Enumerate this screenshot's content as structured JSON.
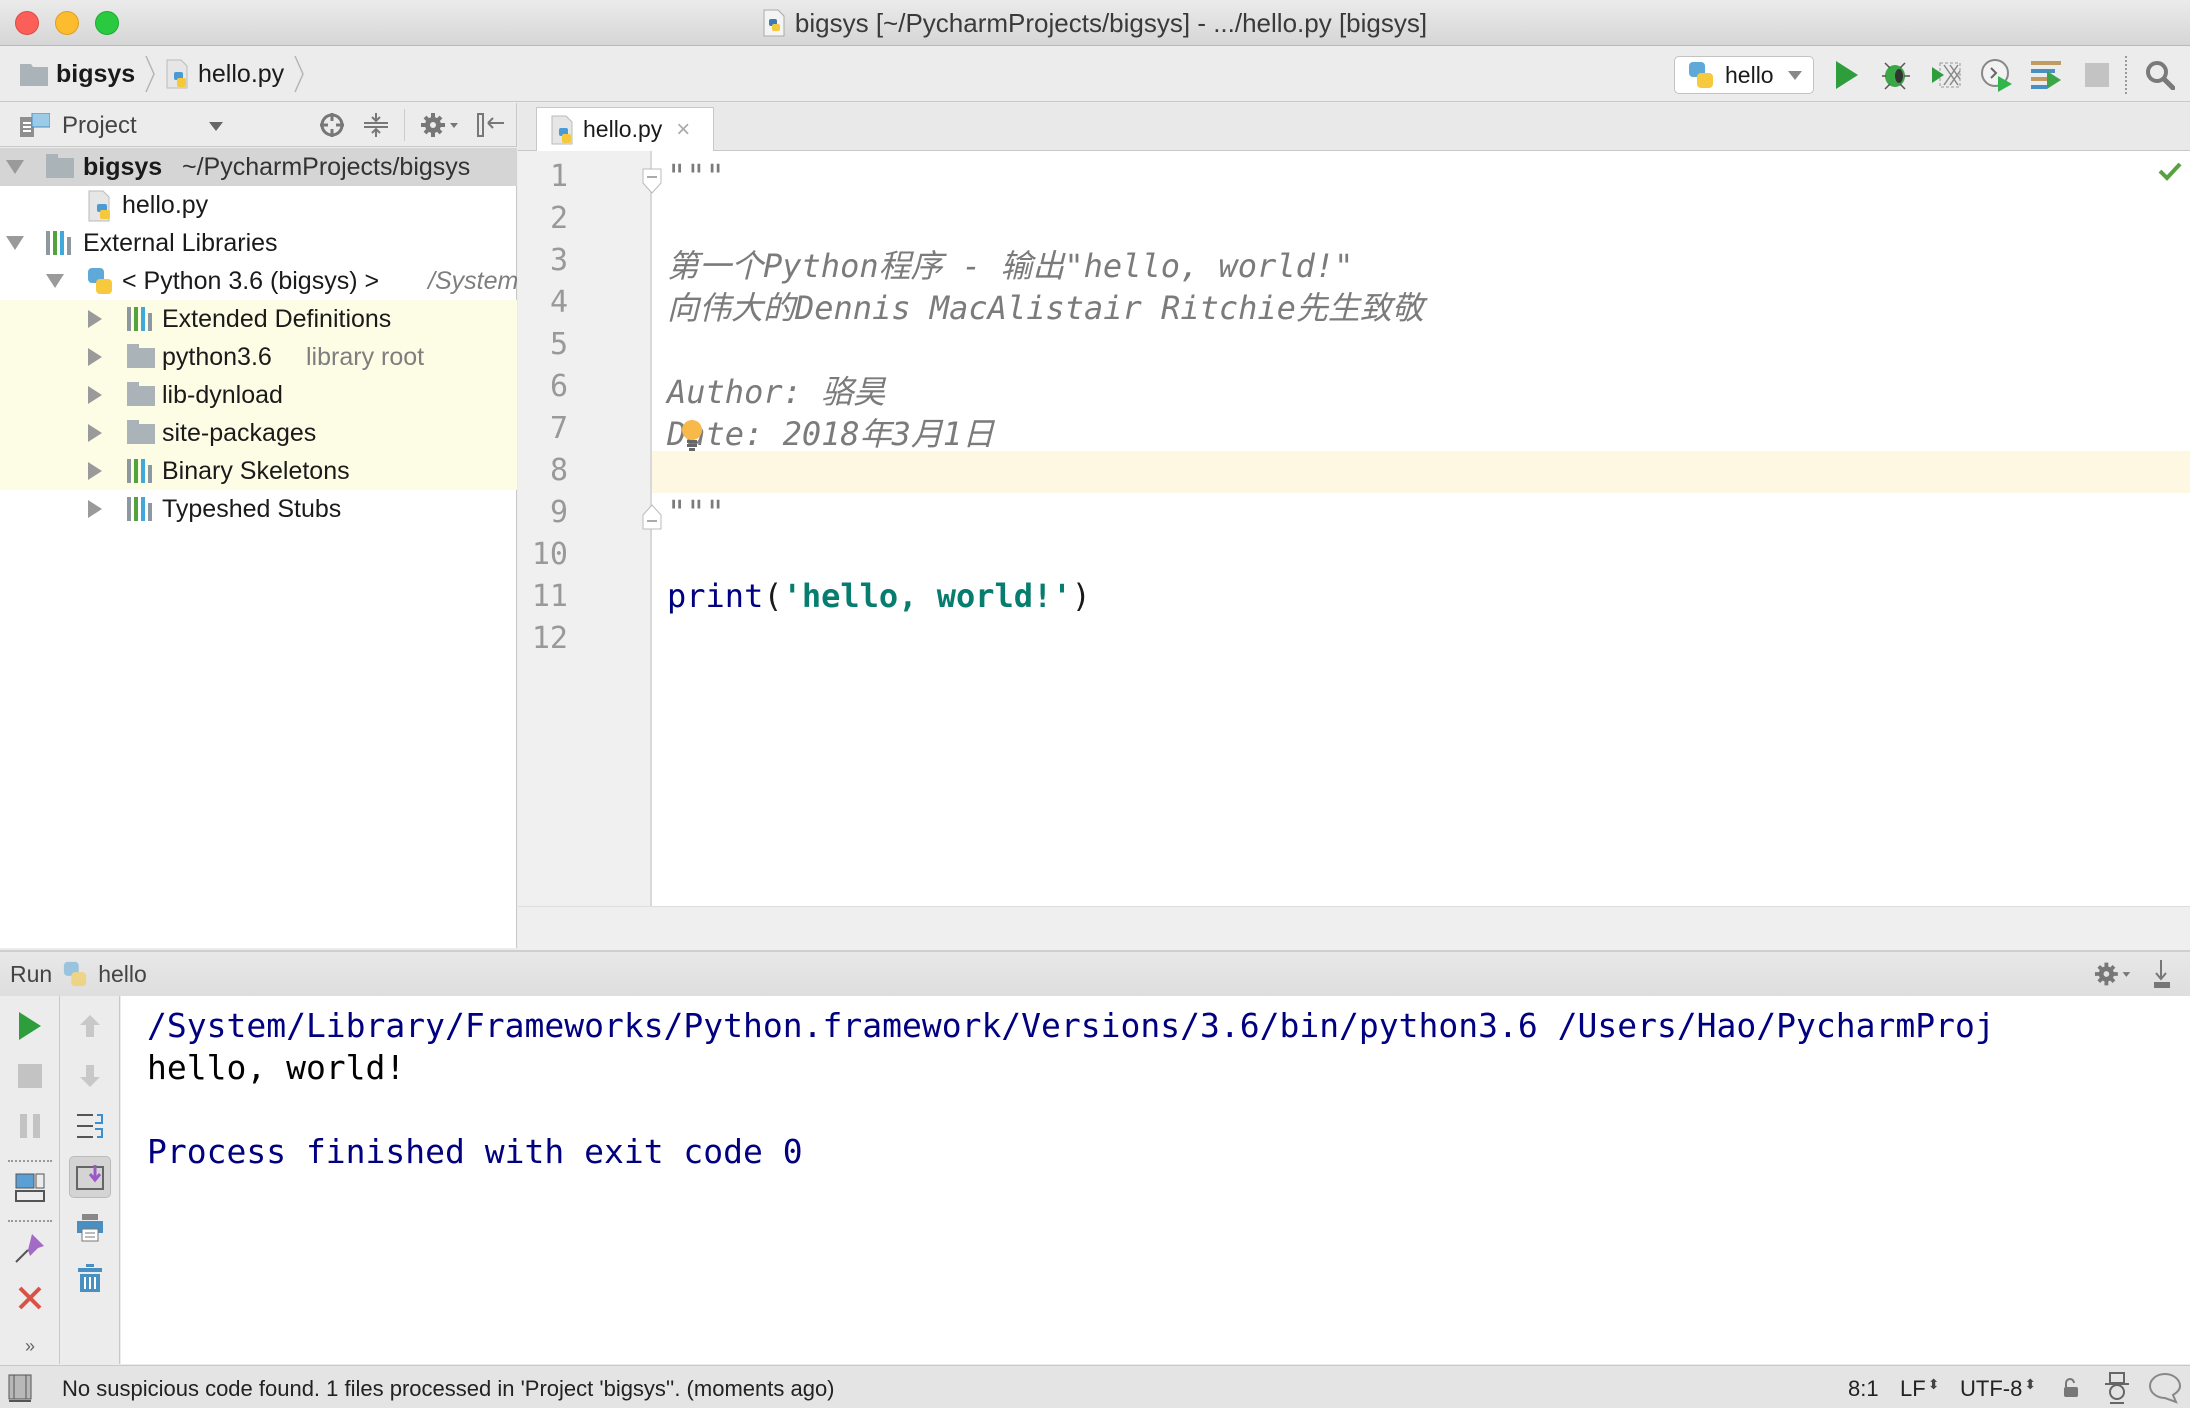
{
  "window": {
    "title": "bigsys [~/PycharmProjects/bigsys] - .../hello.py [bigsys]"
  },
  "navbar": {
    "breadcrumbs": [
      "bigsys",
      "hello.py"
    ],
    "run_config": "hello",
    "toolbar_icons": [
      "run-icon",
      "debug-icon",
      "coverage-icon",
      "profile-icon",
      "concurrency-icon",
      "stop-icon",
      "search-icon"
    ]
  },
  "project_panel": {
    "title": "Project",
    "tree": [
      {
        "label": "bigsys",
        "detail": "~/PycharmProjects/bigsys",
        "icon": "folder-icon",
        "expanded": true,
        "selected": true
      },
      {
        "label": "hello.py",
        "icon": "python-file-icon"
      },
      {
        "label": "External Libraries",
        "icon": "library-icon",
        "expanded": true
      },
      {
        "label": "< Python 3.6 (bigsys) >",
        "detail": "/System",
        "icon": "python-icon",
        "expanded": true
      },
      {
        "label": "Extended Definitions",
        "icon": "library-icon"
      },
      {
        "label": "python3.6",
        "detail": "library root",
        "icon": "folder-icon"
      },
      {
        "label": "lib-dynload",
        "icon": "folder-icon"
      },
      {
        "label": "site-packages",
        "icon": "folder-icon"
      },
      {
        "label": "Binary Skeletons",
        "icon": "library-icon"
      },
      {
        "label": "Typeshed Stubs",
        "icon": "library-icon"
      }
    ]
  },
  "editor": {
    "tab": "hello.py",
    "caret_line": 8,
    "lines": [
      {
        "n": "1",
        "text": "\"\"\""
      },
      {
        "n": "2",
        "text": ""
      },
      {
        "n": "3",
        "text": "第一个Python程序 - 输出\"hello, world!\""
      },
      {
        "n": "4",
        "text": "向伟大的Dennis MacAlistair Ritchie先生致敬"
      },
      {
        "n": "5",
        "text": ""
      },
      {
        "n": "6",
        "text": "Author: 骆昊"
      },
      {
        "n": "7",
        "text": "Date: 2018年3月1日"
      },
      {
        "n": "8",
        "text": ""
      },
      {
        "n": "9",
        "text": "\"\"\""
      },
      {
        "n": "10",
        "text": ""
      },
      {
        "n": "11",
        "kw": "print",
        "open": "(",
        "str": "'hello, world!'",
        "close": ")"
      },
      {
        "n": "12",
        "text": ""
      }
    ]
  },
  "run_panel": {
    "label": "Run",
    "config": "hello",
    "output": [
      {
        "text": "/System/Library/Frameworks/Python.framework/Versions/3.6/bin/python3.6 /Users/Hao/PycharmProj",
        "color": "#000080"
      },
      {
        "text": "hello, world!",
        "color": "#000000"
      },
      {
        "text": "",
        "color": "#000000"
      },
      {
        "text": "Process finished with exit code 0",
        "color": "#000080"
      }
    ]
  },
  "statusbar": {
    "message": "No suspicious code found. 1 files processed in 'Project 'bigsys''. (moments ago)",
    "position": "8:1",
    "line_separator": "LF",
    "encoding": "UTF-8"
  },
  "colors": {
    "run_green": "#2e9e3c",
    "doc_comment": "#7b7b7b",
    "keyword": "#000080",
    "string": "#067d6f",
    "caret_line": "#fef8e3",
    "library_highlight": "#fdfde6"
  }
}
